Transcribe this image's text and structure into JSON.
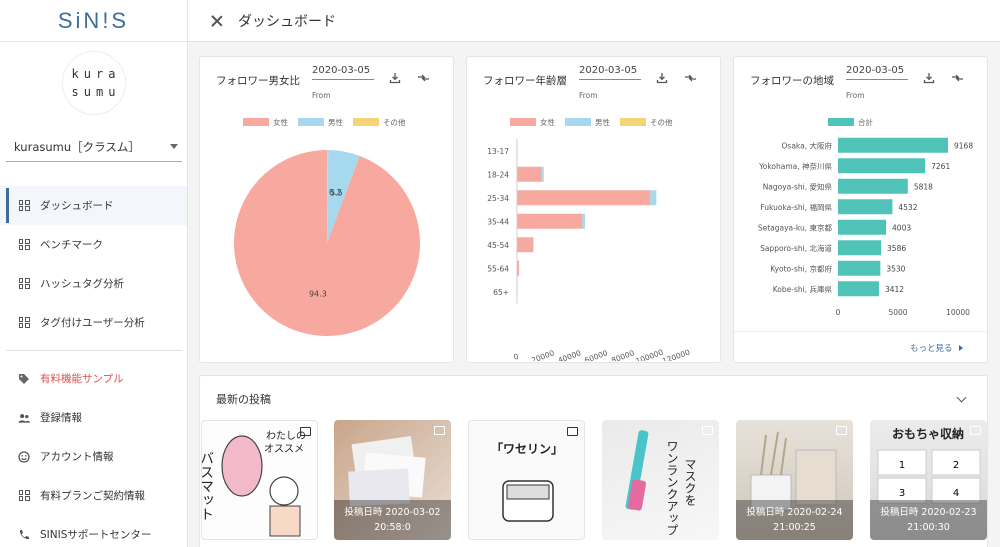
{
  "app": {
    "brand": "SiN!S",
    "logo_line1": "kura",
    "logo_line2": "sumu"
  },
  "account": {
    "selected": "kurasumu［クラスム］"
  },
  "nav": {
    "main": [
      {
        "label": "ダッシュボード"
      },
      {
        "label": "ベンチマーク"
      },
      {
        "label": "ハッシュタグ分析"
      },
      {
        "label": "タグ付けユーザー分析"
      }
    ],
    "secondary": [
      {
        "label": "有料機能サンプル"
      },
      {
        "label": "登録情報"
      },
      {
        "label": "アカウント情報"
      },
      {
        "label": "有料プランご契約情報"
      },
      {
        "label": "SINISサポートセンター"
      }
    ]
  },
  "header": {
    "title": "ダッシュボード"
  },
  "cards": {
    "gender": {
      "title": "フォロワー男女比",
      "date": "2020-03-05",
      "from": "From"
    },
    "age": {
      "title": "フォロワー年齢層",
      "date": "2020-03-05",
      "from": "From"
    },
    "region": {
      "title": "フォロワーの地域",
      "date": "2020-03-05",
      "from": "From",
      "more": "もっと見る"
    }
  },
  "legend": {
    "female": "女性",
    "male": "男性",
    "other": "その他",
    "total": "合計"
  },
  "colors": {
    "female": "#f7a9a0",
    "male": "#a6d8ee",
    "other": "#f5d377",
    "total": "#4fc3b8",
    "accent": "#3f6d9a"
  },
  "posts": {
    "title": "最新の投稿",
    "items": [
      {
        "caption": "",
        "time": ""
      },
      {
        "caption": "投稿日時 2020-03-02",
        "time": "20:58:0"
      },
      {
        "caption": "",
        "time": ""
      },
      {
        "caption": "",
        "time": ""
      },
      {
        "caption": "投稿日時 2020-02-24",
        "time": "21:00:25"
      },
      {
        "caption": "投稿日時 2020-02-23",
        "time": "21:00:30"
      }
    ]
  },
  "chart_data": [
    {
      "type": "pie",
      "title": "フォロワー男女比",
      "categories": [
        "女性",
        "男性",
        "その他"
      ],
      "values": [
        94.3,
        5.5,
        0.2
      ],
      "labels": [
        "94.3",
        "5.5",
        "0.2"
      ]
    },
    {
      "type": "bar",
      "orientation": "horizontal",
      "stacked": true,
      "title": "フォロワー年齢層",
      "categories": [
        "13-17",
        "18-24",
        "25-34",
        "35-44",
        "45-54",
        "55-64",
        "65+"
      ],
      "series": [
        {
          "name": "女性",
          "values": [
            0,
            18500,
            100000,
            49000,
            12000,
            1500,
            0
          ]
        },
        {
          "name": "男性",
          "values": [
            0,
            1500,
            4500,
            2000,
            400,
            100,
            0
          ]
        },
        {
          "name": "その他",
          "values": [
            0,
            0,
            0,
            0,
            0,
            0,
            0
          ]
        }
      ],
      "xlim": [
        0,
        120000
      ],
      "xticks": [
        0,
        20000,
        40000,
        60000,
        80000,
        100000,
        120000
      ]
    },
    {
      "type": "bar",
      "orientation": "horizontal",
      "title": "フォロワーの地域",
      "categories": [
        "Osaka, 大阪府",
        "Yokohama, 神奈川県",
        "Nagoya-shi, 愛知県",
        "Fukuoka-shi, 福岡県",
        "Setagaya-ku, 東京都",
        "Sapporo-shi, 北海道",
        "Kyoto-shi, 京都府",
        "Kobe-shi, 兵庫県"
      ],
      "series": [
        {
          "name": "合計",
          "values": [
            9168,
            7261,
            5818,
            4532,
            4003,
            3586,
            3530,
            3412
          ]
        }
      ],
      "xlim": [
        0,
        10000
      ],
      "xticks": [
        0,
        5000,
        10000
      ]
    }
  ]
}
